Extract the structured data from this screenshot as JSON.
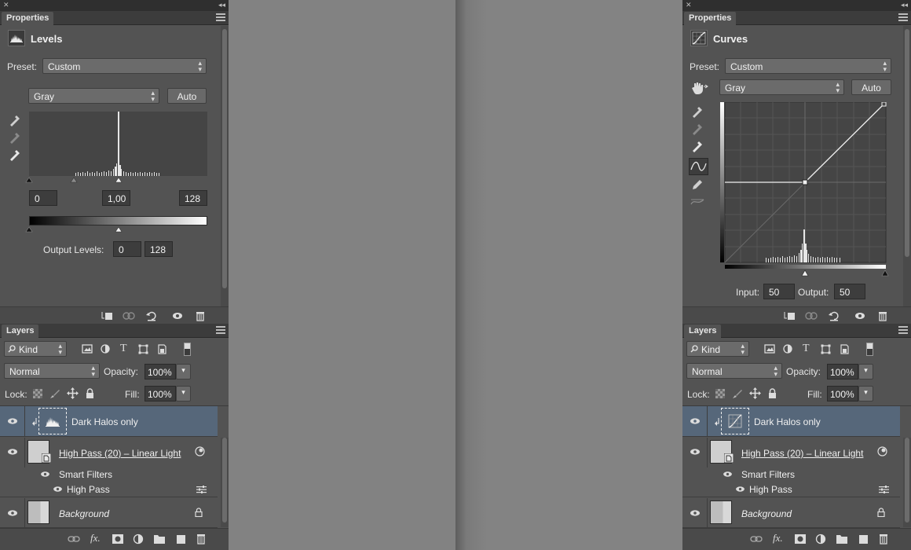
{
  "left": {
    "properties_tab": "Properties",
    "adjustment_title": "Levels",
    "preset_label": "Preset:",
    "preset_value": "Custom",
    "channel": "Gray",
    "auto_label": "Auto",
    "input_black": "0",
    "input_gamma": "1,00",
    "input_white": "128",
    "output_levels_label": "Output Levels:",
    "output_black": "0",
    "output_white": "128"
  },
  "right": {
    "properties_tab": "Properties",
    "adjustment_title": "Curves",
    "preset_label": "Preset:",
    "preset_value": "Custom",
    "channel": "Gray",
    "auto_label": "Auto",
    "input_label": "Input:",
    "input_value": "50",
    "output_label": "Output:",
    "output_value": "50"
  },
  "layers": {
    "tab": "Layers",
    "filter_kind": "Kind",
    "blend_mode": "Normal",
    "opacity_label": "Opacity:",
    "opacity_value": "100%",
    "lock_label": "Lock:",
    "fill_label": "Fill:",
    "fill_value": "100%",
    "rows": [
      {
        "name": "Dark Halos only"
      },
      {
        "name": "High Pass (20) – Linear Light"
      },
      {
        "name": "Smart Filters"
      },
      {
        "name": "High Pass"
      },
      {
        "name": "Background"
      }
    ]
  },
  "glyphs": {
    "close": "✕",
    "collapse": "◂◂",
    "updown": "▴▾",
    "dropdown": "▾"
  },
  "colors": {
    "panel_bg": "#535353",
    "selected_layer": "#56677a",
    "canvas_gray": "#808080"
  }
}
